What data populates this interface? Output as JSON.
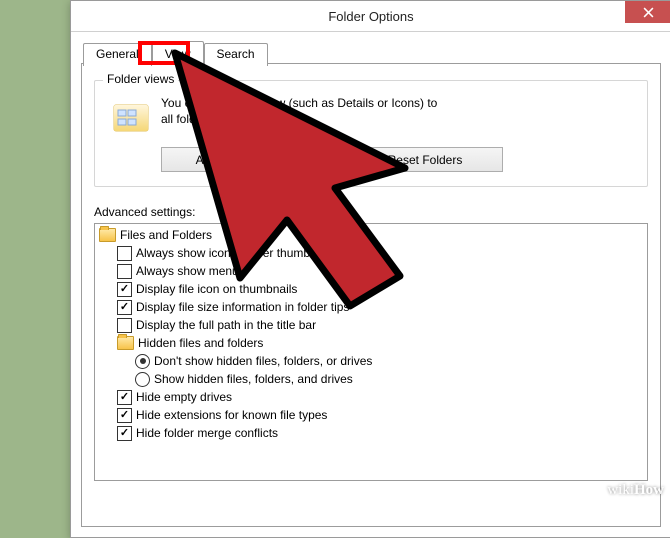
{
  "window": {
    "title": "Folder Options"
  },
  "tabs": {
    "general": "General",
    "view": "View",
    "search": "Search"
  },
  "folder_views": {
    "group_title": "Folder views",
    "desc_line1": "You can apply this view (such as Details or Icons) to",
    "desc_line2": "all folders of this type.",
    "apply_btn": "Apply to Folders",
    "reset_btn": "Reset Folders"
  },
  "advanced": {
    "label": "Advanced settings:",
    "root": "Files and Folders",
    "items": [
      {
        "type": "check",
        "checked": false,
        "label": "Always show icons, never thumbnails"
      },
      {
        "type": "check",
        "checked": false,
        "label": "Always show menus"
      },
      {
        "type": "check",
        "checked": true,
        "label": "Display file icon on thumbnails"
      },
      {
        "type": "check",
        "checked": true,
        "label": "Display file size information in folder tips"
      },
      {
        "type": "check",
        "checked": false,
        "label": "Display the full path in the title bar"
      },
      {
        "type": "folder",
        "label": "Hidden files and folders",
        "children": [
          {
            "type": "radio",
            "checked": true,
            "label": "Don't show hidden files, folders, or drives"
          },
          {
            "type": "radio",
            "checked": false,
            "label": "Show hidden files, folders, and drives"
          }
        ]
      },
      {
        "type": "check",
        "checked": true,
        "label": "Hide empty drives"
      },
      {
        "type": "check",
        "checked": true,
        "label": "Hide extensions for known file types"
      },
      {
        "type": "check",
        "checked": true,
        "label": "Hide folder merge conflicts"
      }
    ]
  },
  "watermark": "wikiHow"
}
